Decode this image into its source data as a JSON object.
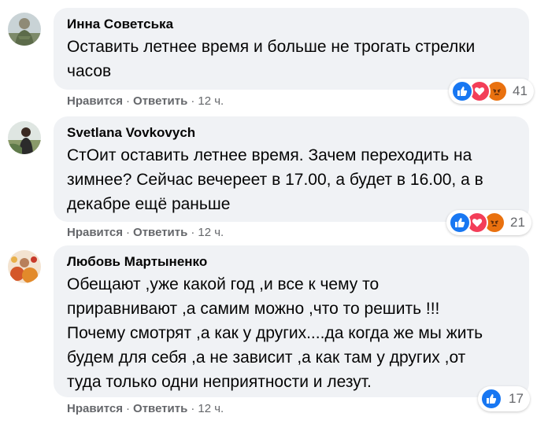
{
  "comments": [
    {
      "author": "Инна Советська",
      "text": "Оставить летнее время и больше не трогать стрелки\nчасов",
      "like_label": "Нравится",
      "reply_label": "Ответить",
      "time": "12 ч.",
      "reactions": [
        "like",
        "love",
        "angry"
      ],
      "reaction_count": "41"
    },
    {
      "author": "Svetlana Vovkovych",
      "text": "СтОит оставить летнее время. Зачем переходить на\nзимнее? Сейчас вечереет в 17.00, а будет в 16.00, а в\nдекабре ещё раньше",
      "like_label": "Нравится",
      "reply_label": "Ответить",
      "time": "12 ч.",
      "reactions": [
        "like",
        "love",
        "angry"
      ],
      "reaction_count": "21"
    },
    {
      "author": "Любовь Мартыненко",
      "text": "Обещают ,уже какой год ,и все к чему то\nприравнивают ,а самим можно ,что то решить !!!\nПочему смотрят ,а как у других....да когда же мы жить\nбудем для себя ,а не зависит ,а как там у других ,от\nтуда только одни неприятности и лезут.",
      "like_label": "Нравится",
      "reply_label": "Ответить",
      "time": "12 ч.",
      "reactions": [
        "like"
      ],
      "reaction_count": "17"
    }
  ],
  "separator": "·",
  "colors": {
    "bubble_bg": "#f0f2f5",
    "secondary_text": "#65676b",
    "like_blue": "#1877f2",
    "love_red": "#f33e58",
    "angry_orange": "#e9710f"
  },
  "icons": {
    "like": "thumbs-up-icon",
    "love": "heart-icon",
    "angry": "angry-face-icon"
  }
}
